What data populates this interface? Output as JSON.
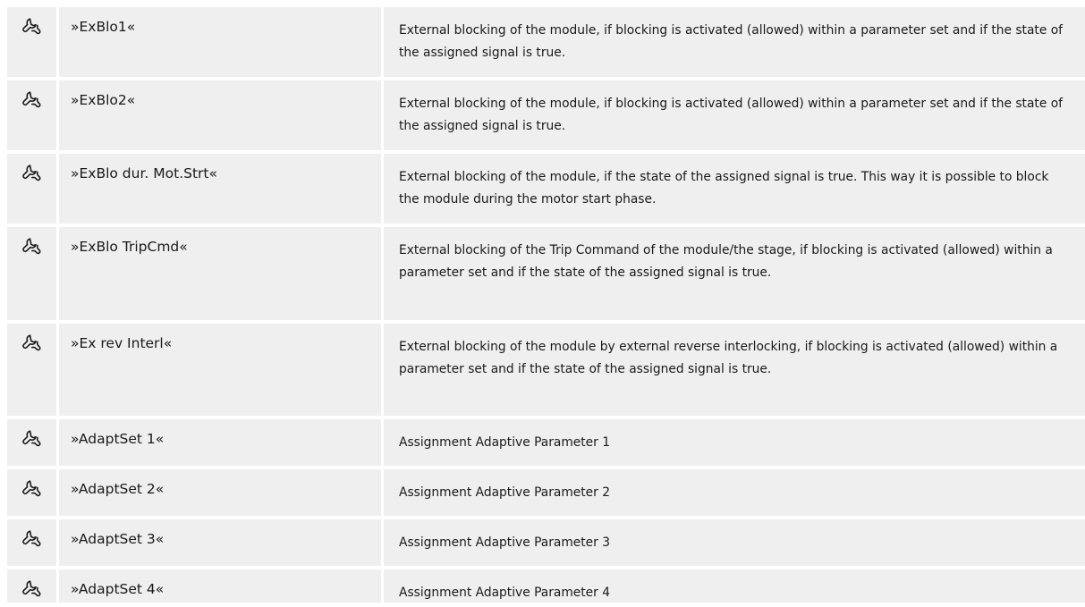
{
  "rows": [
    {
      "icon": "wrench-icon",
      "name": "»ExBlo1«",
      "description": "External blocking of the module, if blocking is activated (allowed) within a parameter set and if the state of the assigned signal is true."
    },
    {
      "icon": "wrench-icon",
      "name": "»ExBlo2«",
      "description": "External blocking of the module, if blocking is activated (allowed) within a parameter set and if the state of the assigned signal is true."
    },
    {
      "icon": "wrench-icon",
      "name": "»ExBlo dur. Mot.Strt«",
      "description": "External blocking of the module, if the state of the assigned signal is true. This way it is possible to block the module during the motor start phase."
    },
    {
      "icon": "wrench-icon",
      "name": "»ExBlo TripCmd«",
      "description": "External blocking of the Trip Command of the module/the stage, if blocking is activated (allowed) within a parameter set and if the state of the assigned signal is true."
    },
    {
      "icon": "wrench-icon",
      "name": "»Ex rev Interl«",
      "description": "External blocking of the module by external reverse interlocking, if blocking is activated (allowed) within a parameter set and if the state of the assigned signal is true."
    },
    {
      "icon": "wrench-icon",
      "name": "»AdaptSet 1«",
      "description": "Assignment Adaptive Parameter 1"
    },
    {
      "icon": "wrench-icon",
      "name": "»AdaptSet 2«",
      "description": "Assignment Adaptive Parameter 2"
    },
    {
      "icon": "wrench-icon",
      "name": "»AdaptSet 3«",
      "description": "Assignment Adaptive Parameter 3"
    },
    {
      "icon": "wrench-icon",
      "name": "»AdaptSet 4«",
      "description": "Assignment Adaptive Parameter 4"
    }
  ]
}
